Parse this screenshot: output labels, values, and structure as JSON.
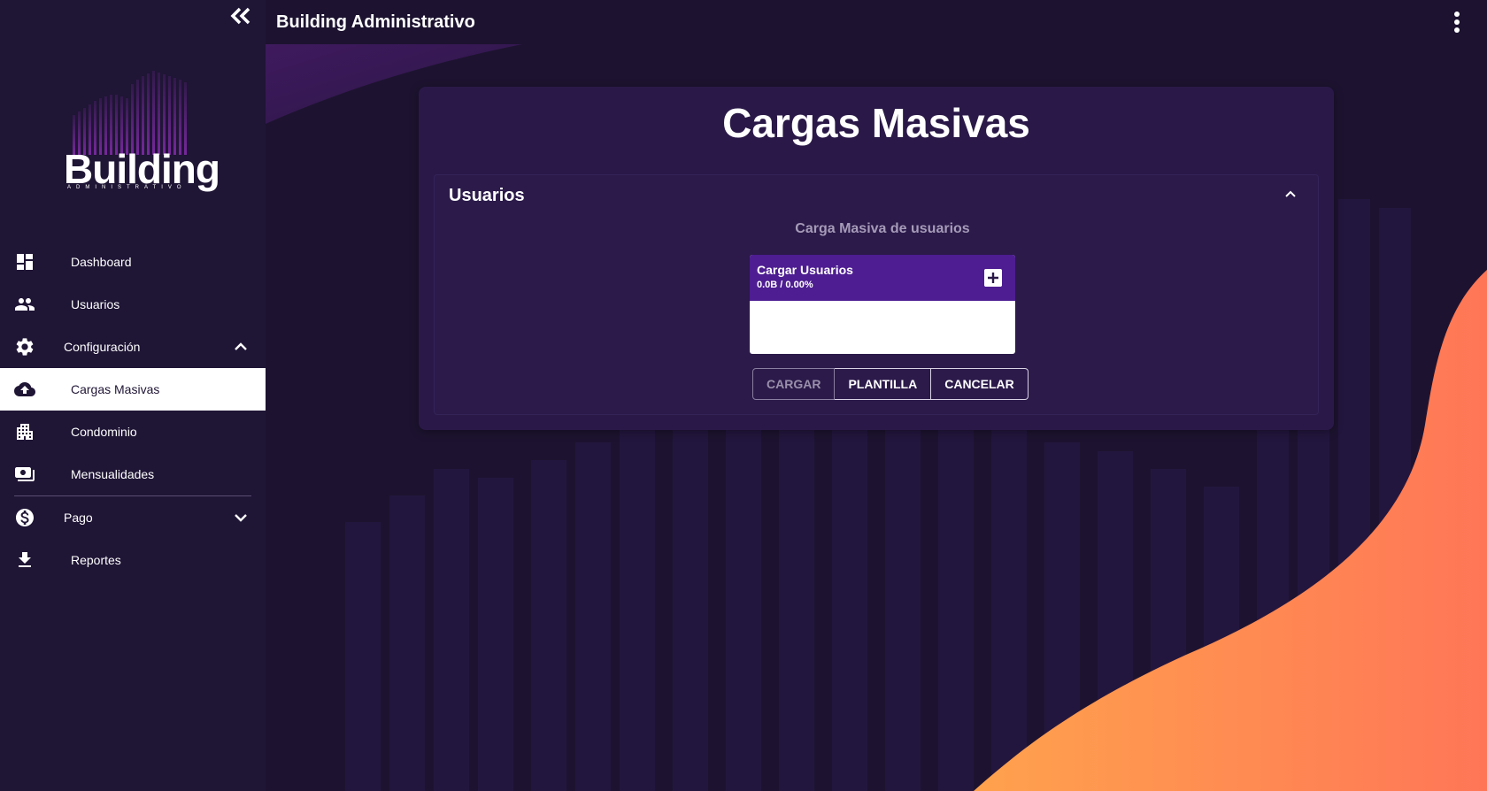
{
  "app": {
    "title": "Building Administrativo",
    "logo_text": "Building",
    "logo_subtext": "ADMINISTRATIVO"
  },
  "sidebar": {
    "items": [
      {
        "label": "Dashboard",
        "icon": "dashboard-icon"
      },
      {
        "label": "Usuarios",
        "icon": "users-icon"
      },
      {
        "label": "Configuración",
        "icon": "gear-icon",
        "expanded": true
      },
      {
        "label": "Cargas Masivas",
        "icon": "cloud-upload-icon",
        "active": true
      },
      {
        "label": "Condominio",
        "icon": "building-icon"
      },
      {
        "label": "Mensualidades",
        "icon": "payments-icon"
      },
      {
        "label": "Pago",
        "icon": "dollar-icon",
        "expanded": false
      },
      {
        "label": "Reportes",
        "icon": "download-icon"
      }
    ]
  },
  "main": {
    "page_title": "Cargas Masivas",
    "panel": {
      "title": "Usuarios",
      "subtitle": "Carga Masiva de usuarios",
      "uploader": {
        "title": "Cargar Usuarios",
        "progress": "0.0B / 0.00%"
      },
      "buttons": {
        "load": "CARGAR",
        "template": "PLANTILLA",
        "cancel": "CANCELAR"
      }
    }
  },
  "colors": {
    "background": "#1d1330",
    "card": "#2a1948",
    "uploader_header": "#4d1d91",
    "accent_gradient_start": "#ff9a4a",
    "accent_gradient_end": "#ff7454"
  }
}
